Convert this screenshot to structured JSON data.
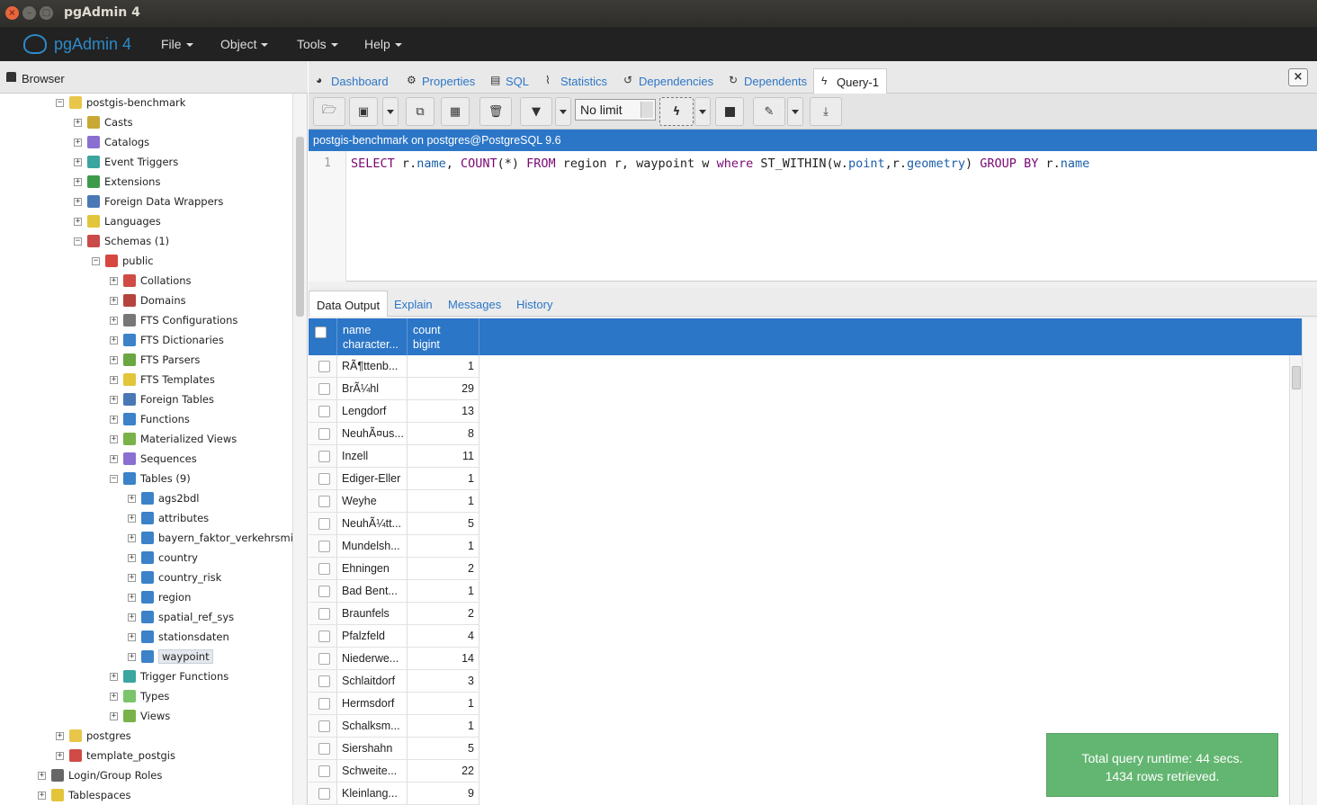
{
  "window": {
    "title": "pgAdmin 4"
  },
  "app": {
    "logo_text": "pgAdmin 4",
    "menus": [
      "File",
      "Object",
      "Tools",
      "Help"
    ]
  },
  "browser": {
    "title": "Browser",
    "tree": [
      {
        "label": "postgis-benchmark",
        "exp": "⊟",
        "color": "#e8c64a"
      },
      {
        "label": "Casts",
        "exp": "⊞",
        "color": "#c9a834"
      },
      {
        "label": "Catalogs",
        "exp": "⊞",
        "color": "#8a6fd1"
      },
      {
        "label": "Event Triggers",
        "exp": "⊞",
        "color": "#3ca5a0"
      },
      {
        "label": "Extensions",
        "exp": "⊞",
        "color": "#3d9a4a"
      },
      {
        "label": "Foreign Data Wrappers",
        "exp": "⊞",
        "color": "#4a78b5"
      },
      {
        "label": "Languages",
        "exp": "⊞",
        "color": "#e3c53a"
      },
      {
        "label": "Schemas (1)",
        "exp": "⊟",
        "color": "#c94a4a"
      },
      {
        "label": "public",
        "exp": "⊟",
        "color": "#d6473f"
      },
      {
        "label": "Collations",
        "exp": "⊞",
        "color": "#d04b45"
      },
      {
        "label": "Domains",
        "exp": "⊞",
        "color": "#b5443c"
      },
      {
        "label": "FTS Configurations",
        "exp": "⊞",
        "color": "#777777"
      },
      {
        "label": "FTS Dictionaries",
        "exp": "⊞",
        "color": "#3b82c9"
      },
      {
        "label": "FTS Parsers",
        "exp": "⊞",
        "color": "#6aa641"
      },
      {
        "label": "FTS Templates",
        "exp": "⊞",
        "color": "#e3c53a"
      },
      {
        "label": "Foreign Tables",
        "exp": "⊞",
        "color": "#4a78b5"
      },
      {
        "label": "Functions",
        "exp": "⊞",
        "color": "#3b82c9"
      },
      {
        "label": "Materialized Views",
        "exp": "⊞",
        "color": "#7ab24a"
      },
      {
        "label": "Sequences",
        "exp": "⊞",
        "color": "#8a6fd1"
      },
      {
        "label": "Tables (9)",
        "exp": "⊟",
        "color": "#3b82c9"
      },
      {
        "label": "ags2bdl",
        "exp": "⊞",
        "color": "#3b82c9"
      },
      {
        "label": "attributes",
        "exp": "⊞",
        "color": "#3b82c9"
      },
      {
        "label": "bayern_faktor_verkehrsmi",
        "exp": "⊞",
        "color": "#3b82c9"
      },
      {
        "label": "country",
        "exp": "⊞",
        "color": "#3b82c9"
      },
      {
        "label": "country_risk",
        "exp": "⊞",
        "color": "#3b82c9"
      },
      {
        "label": "region",
        "exp": "⊞",
        "color": "#3b82c9"
      },
      {
        "label": "spatial_ref_sys",
        "exp": "⊞",
        "color": "#3b82c9"
      },
      {
        "label": "stationsdaten",
        "exp": "⊞",
        "color": "#3b82c9"
      },
      {
        "label": "waypoint",
        "exp": "⊞",
        "color": "#3b82c9",
        "selected": true
      },
      {
        "label": "Trigger Functions",
        "exp": "⊞",
        "color": "#3ca5a0"
      },
      {
        "label": "Types",
        "exp": "⊞",
        "color": "#7ac46a"
      },
      {
        "label": "Views",
        "exp": "⊞",
        "color": "#7ab24a"
      },
      {
        "label": "postgres",
        "exp": "⊞",
        "color": "#e8c64a"
      },
      {
        "label": "template_postgis",
        "exp": "⊞",
        "color": "#d04b45"
      },
      {
        "label": "Login/Group Roles",
        "exp": "⊞",
        "color": "#666666"
      },
      {
        "label": "Tablespaces",
        "exp": "⊞",
        "color": "#e3c53a"
      }
    ]
  },
  "tabs": [
    {
      "label": "Dashboard",
      "icon": "dashboard-icon",
      "glyph": "◕"
    },
    {
      "label": "Properties",
      "icon": "properties-icon",
      "glyph": "⚙"
    },
    {
      "label": "SQL",
      "icon": "sql-icon",
      "glyph": "▤"
    },
    {
      "label": "Statistics",
      "icon": "statistics-icon",
      "glyph": "⌇"
    },
    {
      "label": "Dependencies",
      "icon": "dependencies-icon",
      "glyph": "↺"
    },
    {
      "label": "Dependents",
      "icon": "dependents-icon",
      "glyph": "↻"
    },
    {
      "label": "Query-1",
      "icon": "lightning-icon",
      "glyph": "ϟ",
      "active": true
    }
  ],
  "toolbar": {
    "limit": "No limit"
  },
  "connection": "postgis-benchmark on postgres@PostgreSQL 9.6",
  "editor": {
    "line_number": "1",
    "query": "SELECT r.name, COUNT(*) FROM region r, waypoint w where ST_WITHIN(w.point,r.geometry) GROUP BY r.name"
  },
  "output_tabs": [
    "Data Output",
    "Explain",
    "Messages",
    "History"
  ],
  "grid": {
    "columns": [
      {
        "name": "name",
        "type": "character..."
      },
      {
        "name": "count",
        "type": "bigint"
      }
    ],
    "rows": [
      [
        "RÃ¶ttenb...",
        "1"
      ],
      [
        "BrÃ¼hl",
        "29"
      ],
      [
        "Lengdorf",
        "13"
      ],
      [
        "NeuhÃ¤us...",
        "8"
      ],
      [
        "Inzell",
        "11"
      ],
      [
        "Ediger-Eller",
        "1"
      ],
      [
        "Weyhe",
        "1"
      ],
      [
        "NeuhÃ¼tt...",
        "5"
      ],
      [
        "Mundelsh...",
        "1"
      ],
      [
        "Ehningen",
        "2"
      ],
      [
        "Bad Bent...",
        "1"
      ],
      [
        "Braunfels",
        "2"
      ],
      [
        "Pfalzfeld",
        "4"
      ],
      [
        "Niederwe...",
        "14"
      ],
      [
        "Schlaitdorf",
        "3"
      ],
      [
        "Hermsdorf",
        "1"
      ],
      [
        "Schalksm...",
        "1"
      ],
      [
        "Siershahn",
        "5"
      ],
      [
        "Schweite...",
        "22"
      ],
      [
        "Kleinlang...",
        "9"
      ]
    ]
  },
  "toast": {
    "line1": "Total query runtime: 44 secs.",
    "line2": "1434 rows retrieved."
  }
}
